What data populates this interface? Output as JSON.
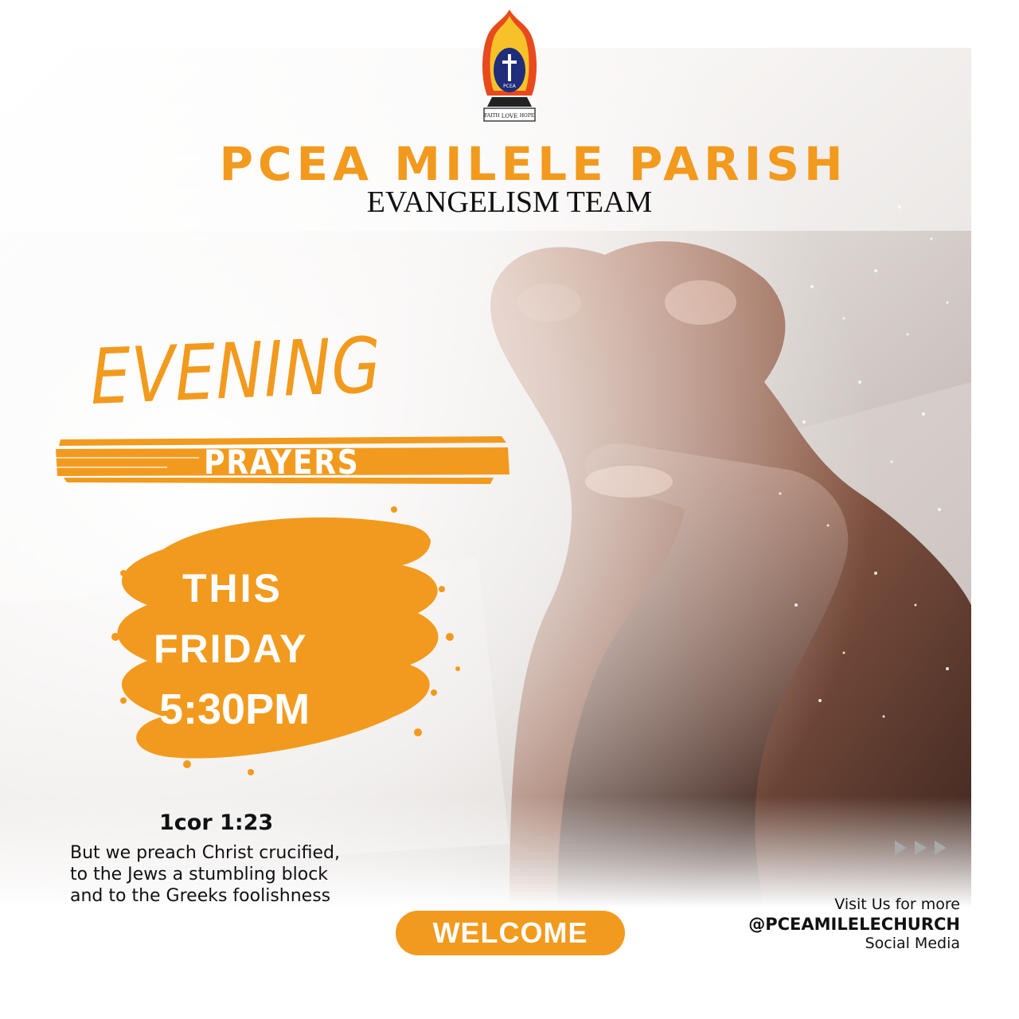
{
  "header": {
    "logo": {
      "name": "pcea-logo-icon",
      "motto_left": "FAITH",
      "motto_center": "LOVE",
      "motto_right": "HOPE",
      "emblem_text": "PCEA"
    },
    "title": "PCEA MILELE PARISH",
    "subtitle": "EVANGELISM TEAM"
  },
  "event": {
    "title_script": "EVENING",
    "title_banner": "PRAYERS",
    "day_line1": "THIS",
    "day_line2": "FRIDAY",
    "time": "5:30PM"
  },
  "verse": {
    "reference": "1cor 1:23",
    "lines": [
      "But we preach Christ crucified,",
      "to the Jews a stumbling block",
      "and to the Greeks foolishness"
    ]
  },
  "cta": {
    "welcome_label": "WELCOME"
  },
  "social": {
    "line1": "Visit Us for more",
    "handle": "@PCEAMILELECHURCH",
    "line3": "Social Media"
  },
  "decor": {
    "arrows_icon": "triple-arrow-right-icon",
    "photo": "praying-hands-photo"
  },
  "colors": {
    "accent": "#f29a1e",
    "text": "#111111",
    "white": "#ffffff"
  }
}
